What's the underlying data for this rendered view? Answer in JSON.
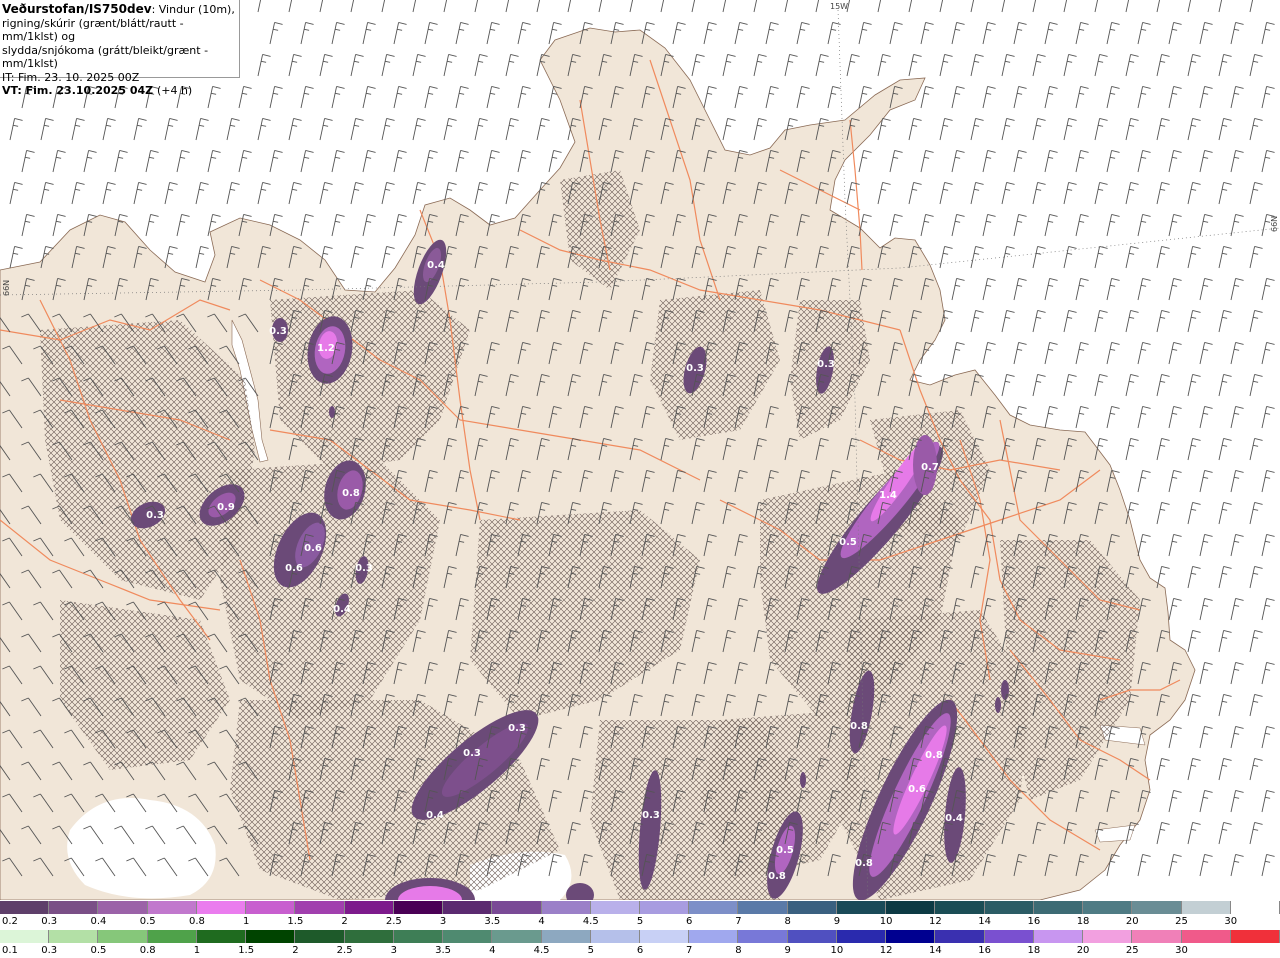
{
  "info": {
    "title": "Veðurstofan/IS750dev",
    "line1_rest": ": Vindur (10m),",
    "line2": "rigning/skúrir (grænt/blátt/rautt - mm/1klst) og",
    "line3": "slydda/snjókoma (grátt/bleikt/grænt - mm/1klst)",
    "it": "IT: Fim. 23. 10. 2025 00Z",
    "vt": "VT: Fim. 23.10.2025 04Z",
    "vt_offset": "(+4 h)"
  },
  "grid_labels": {
    "top": "15W",
    "left": "66N",
    "right": "66N"
  },
  "colors": {
    "land": "#f1e6d8",
    "sea": "#ffffff",
    "roads": "#f08a5d",
    "barbs": "#555555"
  },
  "precip_labels": [
    {
      "text": "0.4"
    },
    {
      "text": "0.3"
    },
    {
      "text": "1.2"
    },
    {
      "text": "0.3"
    },
    {
      "text": "0.3"
    },
    {
      "text": "0.7"
    },
    {
      "text": "1.4"
    },
    {
      "text": "0.5"
    },
    {
      "text": "0.8"
    },
    {
      "text": "0.3"
    },
    {
      "text": "0.9"
    },
    {
      "text": "0.6"
    },
    {
      "text": "0.6"
    },
    {
      "text": "0.3"
    },
    {
      "text": "0.4"
    },
    {
      "text": "0.3"
    },
    {
      "text": "0.3"
    },
    {
      "text": "0.4"
    },
    {
      "text": "0.8"
    },
    {
      "text": "0.8"
    },
    {
      "text": "0.3"
    },
    {
      "text": "0.6"
    },
    {
      "text": "0.5"
    },
    {
      "text": "0.8"
    },
    {
      "text": "0.4"
    }
  ],
  "scale_snow": {
    "colors": [
      "#5e3f6a",
      "#7a4f86",
      "#9b62a8",
      "#c178cd",
      "#ea7cee",
      "#c85fcf",
      "#a13fae",
      "#7d1a8c",
      "#4a0055",
      "#5b2a70",
      "#7a4a96",
      "#9b80c8",
      "#b9b0ea",
      "#a89ce0",
      "#7d8fc8",
      "#5a7aa8",
      "#3a6080",
      "#1a4a58",
      "#0d3a44",
      "#1b4d55",
      "#2b5c65",
      "#3d6b74",
      "#4f7b84",
      "#6a8d95",
      "#c3cfd4",
      "#ffffff"
    ],
    "labels": [
      "0.2",
      "0.3",
      "0.4",
      "0.5",
      "0.8",
      "1",
      "1.5",
      "2",
      "2.5",
      "3",
      "3.5",
      "4",
      "4.5",
      "5",
      "6",
      "7",
      "8",
      "9",
      "10",
      "12",
      "14",
      "16",
      "18",
      "20",
      "25",
      "30"
    ]
  },
  "scale_rain": {
    "colors": [
      "#dcf5d8",
      "#b3e0a6",
      "#86c77a",
      "#4fa24a",
      "#1f6b1f",
      "#004400",
      "#1e5a2a",
      "#2f6e3c",
      "#3e7e56",
      "#4f8a70",
      "#6a9a8e",
      "#8da8c0",
      "#b5c0ea",
      "#c8d0f5",
      "#a0a8ee",
      "#7878d8",
      "#5050c0",
      "#2a2aae",
      "#000090",
      "#3a30b0",
      "#7a50d0",
      "#c896f0",
      "#f2a0e0",
      "#f080b8",
      "#f05a8a",
      "#f0303a"
    ],
    "labels": [
      "0.1",
      "0.3",
      "0.5",
      "0.8",
      "1",
      "1.5",
      "2",
      "2.5",
      "3",
      "3.5",
      "4",
      "4.5",
      "5",
      "6",
      "7",
      "8",
      "9",
      "10",
      "12",
      "14",
      "16",
      "18",
      "20",
      "25",
      "30"
    ]
  }
}
